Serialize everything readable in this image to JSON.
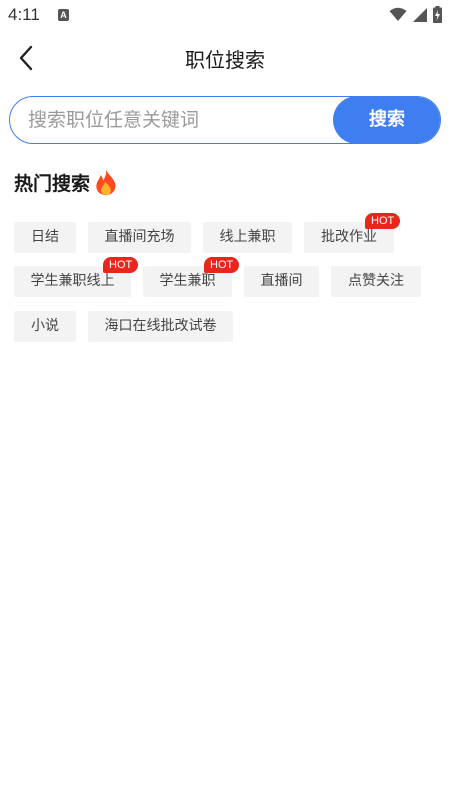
{
  "status_bar": {
    "time": "4:11",
    "app_icon_letter": "A"
  },
  "header": {
    "title": "职位搜索"
  },
  "search": {
    "placeholder": "搜索职位任意关键词",
    "button_label": "搜索"
  },
  "hot": {
    "title": "热门搜索",
    "badge_label": "HOT",
    "tags": [
      {
        "label": "日结",
        "hot": false
      },
      {
        "label": "直播间充场",
        "hot": false
      },
      {
        "label": "线上兼职",
        "hot": false
      },
      {
        "label": "批改作业",
        "hot": true
      },
      {
        "label": "学生兼职线上",
        "hot": true
      },
      {
        "label": "学生兼职",
        "hot": true
      },
      {
        "label": "直播间",
        "hot": false
      },
      {
        "label": "点赞关注",
        "hot": false
      },
      {
        "label": "小说",
        "hot": false
      },
      {
        "label": "海口在线批改试卷",
        "hot": false
      }
    ]
  },
  "colors": {
    "accent": "#3e7ef0",
    "hot_badge": "#e8261c",
    "tag_bg": "#f3f3f3"
  }
}
